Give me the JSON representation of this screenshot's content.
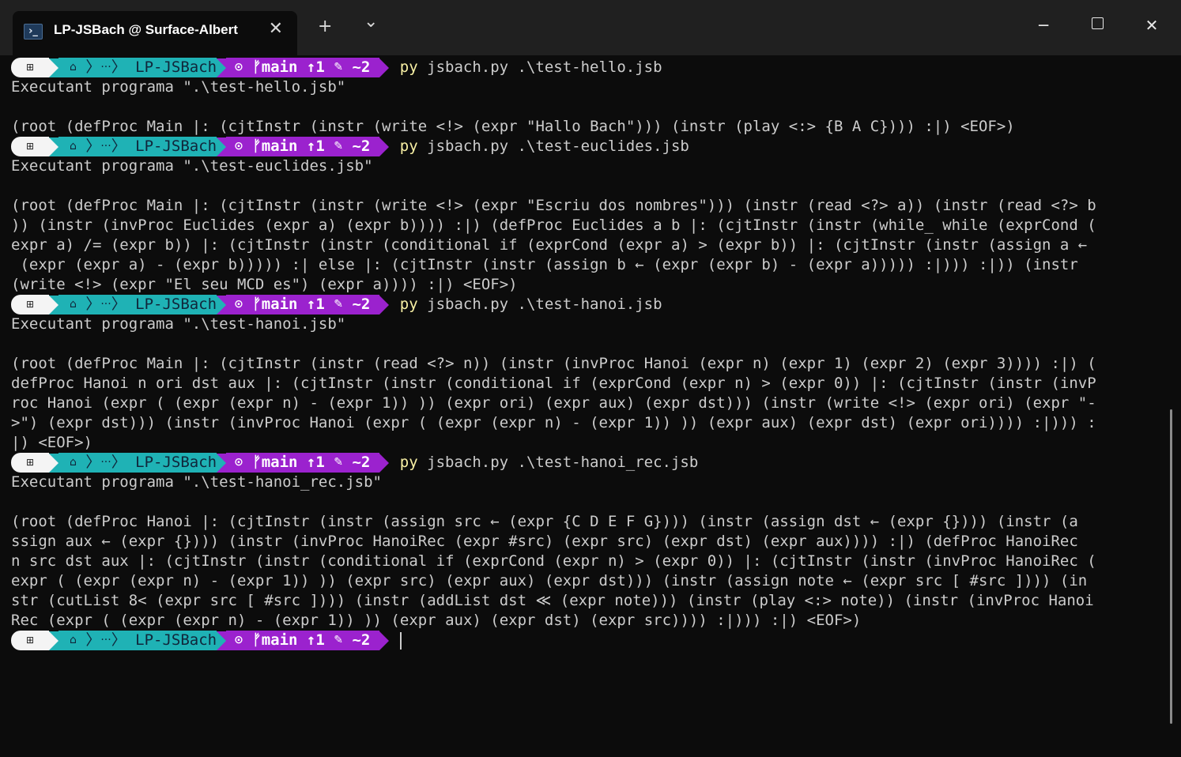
{
  "window": {
    "tab_title": "LP-JSBach @ Surface-Albert",
    "tab_icon": "powershell-icon",
    "new_tab_symbol": "+",
    "dropdown_symbol": "⌄",
    "close_tab_symbol": "✕",
    "minimize_symbol": "─",
    "close_symbol": "✕"
  },
  "prompt": {
    "os_glyph": "⊞",
    "home_glyph": "⌂",
    "ellipsis": "···",
    "dir": "LP-JSBach",
    "git_glyph": "⊙",
    "branch_glyph": "ᚠ",
    "branch": "main",
    "ahead": "↑1",
    "edit_glyph": "✎",
    "changes": "~2"
  },
  "colors": {
    "path_segment": "#1fb2b5",
    "git_segment": "#9b22ce",
    "os_segment": "#f4f4f4",
    "command_highlight": "#f9f1a5",
    "background": "#0c0c0c"
  },
  "terminal": {
    "runs": [
      {
        "command_py": "py",
        "command_args": "jsbach.py .\\test-hello.jsb",
        "output": [
          "Executant programa \".\\test-hello.jsb\"",
          "",
          "(root (defProc Main |: (cjtInstr (instr (write <!> (expr \"Hallo Bach\"))) (instr (play <:> {B A C}))) :|) <EOF>)"
        ]
      },
      {
        "command_py": "py",
        "command_args": "jsbach.py .\\test-euclides.jsb",
        "output": [
          "Executant programa \".\\test-euclides.jsb\"",
          "",
          "(root (defProc Main |: (cjtInstr (instr (write <!> (expr \"Escriu dos nombres\"))) (instr (read <?> a)) (instr (read <?> b",
          ")) (instr (invProc Euclides (expr a) (expr b)))) :|) (defProc Euclides a b |: (cjtInstr (instr (while_ while (exprCond (",
          "expr a) /= (expr b)) |: (cjtInstr (instr (conditional if (exprCond (expr a) > (expr b)) |: (cjtInstr (instr (assign a ←",
          " (expr (expr a) - (expr b))))) :| else |: (cjtInstr (instr (assign b ← (expr (expr b) - (expr a))))) :|))) :|)) (instr",
          "(write <!> (expr \"El seu MCD es\") (expr a)))) :|) <EOF>)"
        ]
      },
      {
        "command_py": "py",
        "command_args": "jsbach.py .\\test-hanoi.jsb",
        "output": [
          "Executant programa \".\\test-hanoi.jsb\"",
          "",
          "(root (defProc Main |: (cjtInstr (instr (read <?> n)) (instr (invProc Hanoi (expr n) (expr 1) (expr 2) (expr 3)))) :|) (",
          "defProc Hanoi n ori dst aux |: (cjtInstr (instr (conditional if (exprCond (expr n) > (expr 0)) |: (cjtInstr (instr (invP",
          "roc Hanoi (expr ( (expr (expr n) - (expr 1)) )) (expr ori) (expr aux) (expr dst))) (instr (write <!> (expr ori) (expr \"-",
          ">\") (expr dst))) (instr (invProc Hanoi (expr ( (expr (expr n) - (expr 1)) )) (expr aux) (expr dst) (expr ori)))) :|))) :",
          "|) <EOF>)"
        ]
      },
      {
        "command_py": "py",
        "command_args": "jsbach.py .\\test-hanoi_rec.jsb",
        "output": [
          "Executant programa \".\\test-hanoi_rec.jsb\"",
          "",
          "(root (defProc Hanoi |: (cjtInstr (instr (assign src ← (expr {C D E F G}))) (instr (assign dst ← (expr {}))) (instr (a",
          "ssign aux ← (expr {}))) (instr (invProc HanoiRec (expr #src) (expr src) (expr dst) (expr aux)))) :|) (defProc HanoiRec",
          "n src dst aux |: (cjtInstr (instr (conditional if (exprCond (expr n) > (expr 0)) |: (cjtInstr (instr (invProc HanoiRec (",
          "expr ( (expr (expr n) - (expr 1)) )) (expr src) (expr aux) (expr dst))) (instr (assign note ← (expr src [ #src ]))) (in",
          "str (cutList 8< (expr src [ #src ]))) (instr (addList dst ≪ (expr note))) (instr (play <:> note)) (instr (invProc Hanoi",
          "Rec (expr ( (expr (expr n) - (expr 1)) )) (expr aux) (expr dst) (expr src)))) :|))) :|) <EOF>)"
        ]
      }
    ]
  }
}
